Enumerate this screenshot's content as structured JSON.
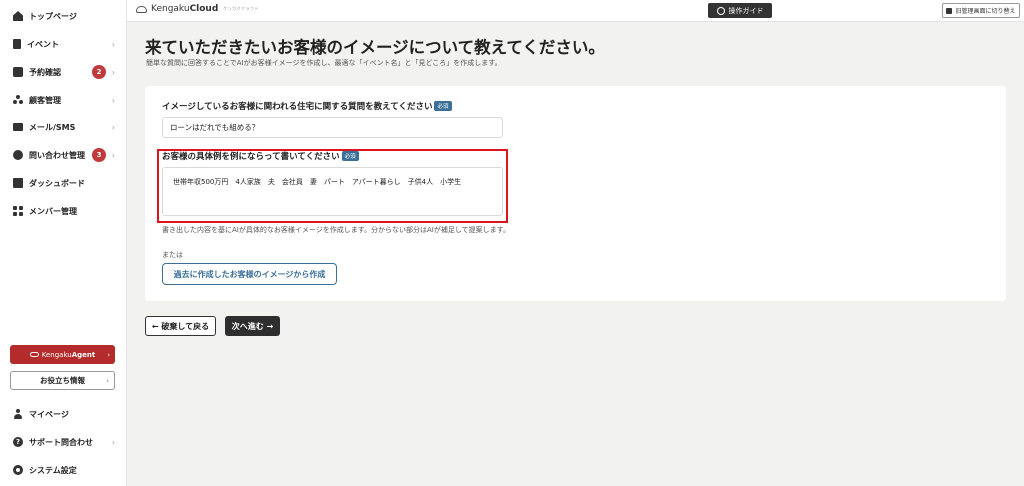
{
  "sidebar": {
    "items": [
      {
        "label": "トップページ",
        "icon": "home-icon"
      },
      {
        "label": "イベント",
        "icon": "document-icon",
        "chevron": "›"
      },
      {
        "label": "予約確認",
        "icon": "calendar-icon",
        "chevron": "›",
        "badge": "2"
      },
      {
        "label": "顧客管理",
        "icon": "people-icon",
        "chevron": "›"
      },
      {
        "label": "メール/SMS",
        "icon": "mail-icon",
        "chevron": "›"
      },
      {
        "label": "問い合わせ管理",
        "icon": "chat-icon",
        "chevron": "›",
        "badge": "3"
      },
      {
        "label": "ダッシュボード",
        "icon": "chart-icon"
      },
      {
        "label": "メンバー管理",
        "icon": "grid-icon"
      }
    ],
    "agent_button": {
      "brand": "Kengaku",
      "brand_bold": "Agent",
      "chevron": "›"
    },
    "useful_info_button": {
      "label": "お役立ち情報",
      "chevron": "›"
    },
    "bottom_items": [
      {
        "label": "マイページ",
        "icon": "user-icon"
      },
      {
        "label": "サポート問合わせ",
        "icon": "help-icon",
        "chevron": "›"
      },
      {
        "label": "システム設定",
        "icon": "gear-icon"
      }
    ]
  },
  "header": {
    "logo_prefix": "Kengaku",
    "logo_bold": "Cloud",
    "logo_tag": "ケンガククラウド",
    "guide_button": "操作ガイド",
    "switch_button": "旧管理画面に切り替え"
  },
  "main": {
    "title": "来ていただきたいお客様のイメージについて教えてください。",
    "subtitle": "簡単な質問に回答することでAIがお客様イメージを作成し、最適な「イベント名」と「見どころ」を作成します。",
    "q1": {
      "label": "イメージしているお客様に関われる住宅に関する質問を教えてください",
      "required": "必須",
      "value": "ローンはだれでも組める？"
    },
    "q2": {
      "label": "お客様の具体例を例にならって書いてください",
      "required": "必須",
      "value": "世帯年収500万円　4人家族　夫　会社員　妻　パート　アパート暮らし　子供4人　小学生"
    },
    "note": "書き出した内容を基にAIが具体的なお客様イメージを作成します。分からない部分はAIが補足して提案します。",
    "or": "または",
    "past_button": "過去に作成したお客様のイメージから作成"
  },
  "footer": {
    "back_button": "← 破棄して戻る",
    "next_button": "次へ進む →"
  },
  "colors": {
    "accent_blue": "#3a6f9a",
    "badge_red": "#c0393b",
    "agent_red": "#b32b2b",
    "highlight_red": "#e0141c",
    "dark_button": "#2e2e2e"
  }
}
